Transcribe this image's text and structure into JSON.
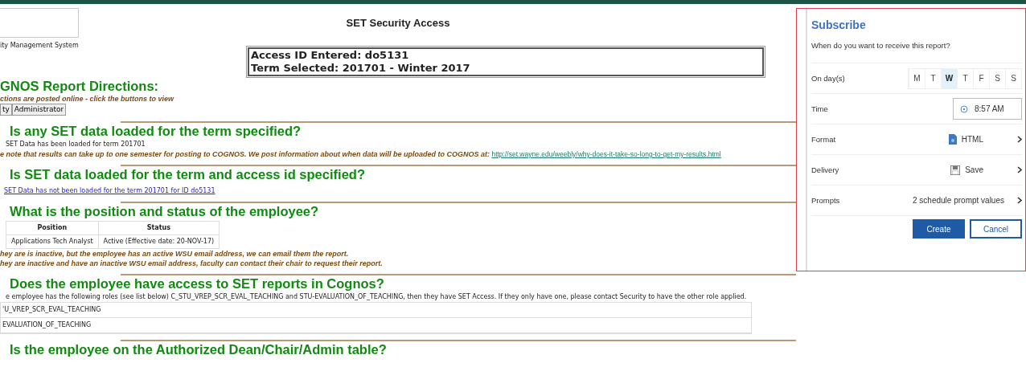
{
  "header": {
    "logo_caption": "ity Management System",
    "title": "SET Security Access"
  },
  "access_box": {
    "lines": [
      "Access ID Entered: do5131",
      "Term Selected: 201701 - Winter 2017"
    ]
  },
  "directions": {
    "heading": "GNOS Report Directions:",
    "note": "ctions are posted online - click the buttons to view",
    "buttons": [
      "ty",
      "Administrator"
    ]
  },
  "sections": [
    {
      "heading": "Is any SET data loaded for the term specified?",
      "items": [
        {
          "kind": "text",
          "text": "SET Data has been loaded for term 201701"
        },
        {
          "kind": "note",
          "text": "e note that results can take up to one semester for posting to COGNOS.  We post information about when data will be uploaded to COGNOS at:",
          "link": "http://set.wayne.edu/weebly/why-does-it-take-so-long-to-get-my-results.html"
        }
      ]
    },
    {
      "heading": "Is SET data loaded for the term and access id specified?",
      "items": [
        {
          "kind": "link",
          "text": "SET Data has not been loaded for the term 201701 for ID do5131"
        }
      ]
    },
    {
      "heading": "What is the position and status of the employee?",
      "items": [
        {
          "kind": "table",
          "columns": [
            "Position",
            "Status"
          ],
          "rows": [
            [
              "Applications Tech Analyst",
              "Active (Effective date: 20-NOV-17)"
            ]
          ]
        },
        {
          "kind": "note",
          "text": "hey are is inactive, but the employee has an active WSU email address, we can email them the report."
        },
        {
          "kind": "note",
          "text": "hey are inactive and have an inactive WSU email address, faculty can contact their chair to request their report."
        }
      ]
    },
    {
      "heading": "Does the employee have access to SET reports in Cognos?",
      "items": [
        {
          "kind": "text",
          "text": "e employee has the following roles (see list below) C_STU_VREP_SCR_EVAL_TEACHING   and STU-EVALUATION_OF_TEACHING, then they have SET Access. If they only have one, please contact Security to have the other role applied."
        },
        {
          "kind": "list",
          "rows": [
            "'U_VREP_SCR_EVAL_TEACHING",
            "EVALUATION_OF_TEACHING"
          ]
        }
      ]
    },
    {
      "heading": "Is the employee on the Authorized Dean/Chair/Admin table?"
    }
  ],
  "subscribe": {
    "title": "Subscribe",
    "question": "When do you want to receive this report?",
    "rows": [
      {
        "kind": "days",
        "label": "On day(s)",
        "days": [
          {
            "label": "M",
            "selected": false
          },
          {
            "label": "T",
            "selected": false
          },
          {
            "label": "W",
            "selected": true
          },
          {
            "label": "T",
            "selected": false
          },
          {
            "label": "F",
            "selected": false
          },
          {
            "label": "S",
            "selected": false
          },
          {
            "label": "S",
            "selected": false
          }
        ]
      },
      {
        "kind": "time",
        "label": "Time",
        "value": "8:57 AM"
      },
      {
        "kind": "format",
        "label": "Format",
        "value": "HTML"
      },
      {
        "kind": "delivery",
        "label": "Delivery",
        "value": "Save"
      },
      {
        "kind": "prompts",
        "label": "Prompts",
        "value": "2 schedule prompt values"
      }
    ],
    "buttons": [
      {
        "label": "Create",
        "kind": "primary"
      },
      {
        "label": "Cancel",
        "kind": "secondary"
      }
    ]
  }
}
